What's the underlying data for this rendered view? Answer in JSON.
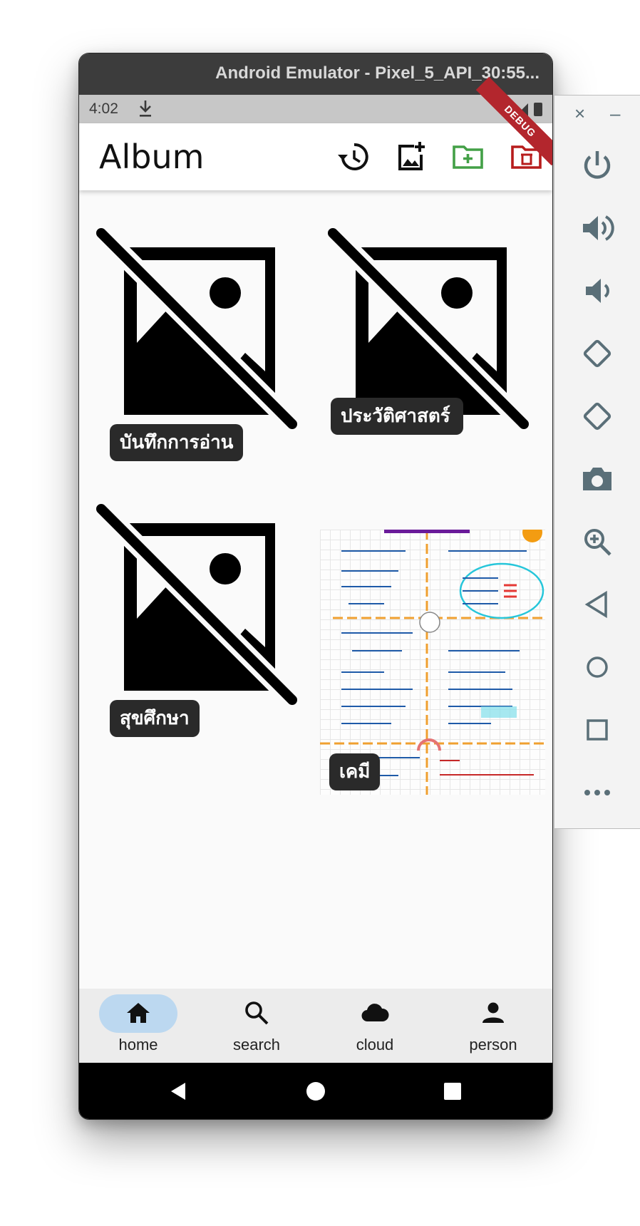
{
  "window": {
    "title": "Android Emulator - Pixel_5_API_30:55..."
  },
  "status_bar": {
    "time": "4:02",
    "debug_banner": "DEBUG"
  },
  "app_bar": {
    "title": "Album",
    "actions": [
      "history-icon",
      "add-photo-icon",
      "create-folder-icon",
      "delete-folder-icon"
    ],
    "colors": {
      "create_folder": "#43a047",
      "delete_folder": "#b71c1c"
    }
  },
  "albums": [
    {
      "label": "บันทึกการอ่าน",
      "image": "image-not-supported-icon"
    },
    {
      "label": "ประวัติศาสตร์",
      "image": "image-not-supported-icon"
    },
    {
      "label": "สุขศึกษา",
      "image": "image-not-supported-icon"
    },
    {
      "label": "เคมี",
      "image": "chemistry-notes-photo"
    }
  ],
  "bottom_nav": {
    "selected": "home",
    "selected_color": "#bcd8f0",
    "items": [
      {
        "icon": "home-icon",
        "label": "home"
      },
      {
        "icon": "search-icon",
        "label": "search"
      },
      {
        "icon": "cloud-icon",
        "label": "cloud"
      },
      {
        "icon": "person-icon",
        "label": "person"
      }
    ]
  },
  "system_nav": [
    "back-icon",
    "home-circle-icon",
    "recents-icon"
  ],
  "side_toolbar": {
    "close": "×",
    "minimize": "–",
    "buttons": [
      "power-icon",
      "volume-up-icon",
      "volume-down-icon",
      "rotate-left-icon",
      "rotate-right-icon",
      "camera-icon",
      "zoom-icon",
      "back-triangle-icon",
      "home-circle-icon",
      "overview-square-icon",
      "more-icon"
    ],
    "icon_color": "#5a6f78"
  }
}
